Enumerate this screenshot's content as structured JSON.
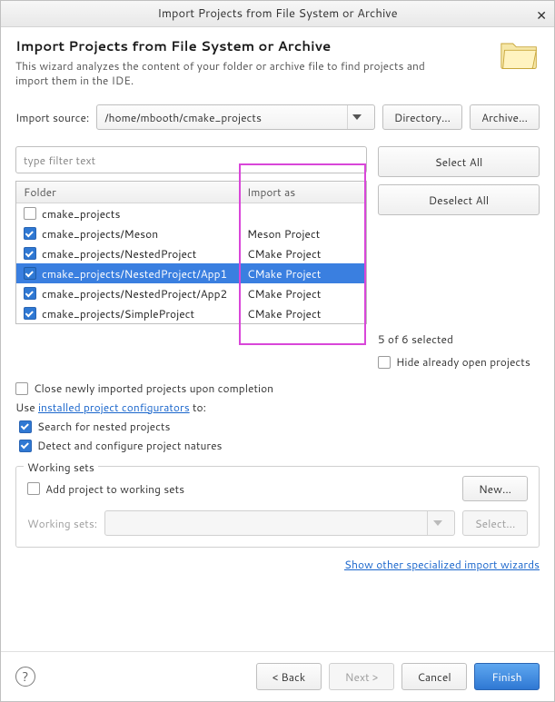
{
  "titlebar": {
    "title": "Import Projects from File System or Archive"
  },
  "header": {
    "title": "Import Projects from File System or Archive",
    "desc": "This wizard analyzes the content of your folder or archive file to find projects and import them in the IDE."
  },
  "source": {
    "label": "Import source:",
    "value": "/home/mbooth/cmake_projects",
    "directory_btn": "Directory...",
    "archive_btn": "Archive..."
  },
  "filter": {
    "placeholder": "type filter text"
  },
  "side": {
    "select_all": "Select All",
    "deselect_all": "Deselect All",
    "selected_status": "5 of 6 selected",
    "hide_open": "Hide already open projects"
  },
  "table": {
    "folder_header": "Folder",
    "import_header": "Import as",
    "rows": [
      {
        "checked": false,
        "folder": "cmake_projects",
        "import_as": "",
        "selected": false
      },
      {
        "checked": true,
        "folder": "cmake_projects/Meson",
        "import_as": "Meson Project",
        "selected": false
      },
      {
        "checked": true,
        "folder": "cmake_projects/NestedProject",
        "import_as": "CMake Project",
        "selected": false
      },
      {
        "checked": true,
        "folder": "cmake_projects/NestedProject/App1",
        "import_as": "CMake Project",
        "selected": true
      },
      {
        "checked": true,
        "folder": "cmake_projects/NestedProject/App2",
        "import_as": "CMake Project",
        "selected": false
      },
      {
        "checked": true,
        "folder": "cmake_projects/SimpleProject",
        "import_as": "CMake Project",
        "selected": false
      }
    ]
  },
  "opts": {
    "close_after": "Close newly imported projects upon completion",
    "use_prefix": "Use ",
    "configurators_link": "installed project configurators",
    "use_suffix": " to:",
    "search_nested": "Search for nested projects",
    "detect_natures": "Detect and configure project natures"
  },
  "ws": {
    "legend": "Working sets",
    "add_label": "Add project to working sets",
    "new_btn": "New...",
    "sets_label": "Working sets:",
    "select_btn": "Select..."
  },
  "special_link": "Show other specialized import wizards",
  "footer": {
    "back": "< Back",
    "next": "Next >",
    "cancel": "Cancel",
    "finish": "Finish"
  }
}
